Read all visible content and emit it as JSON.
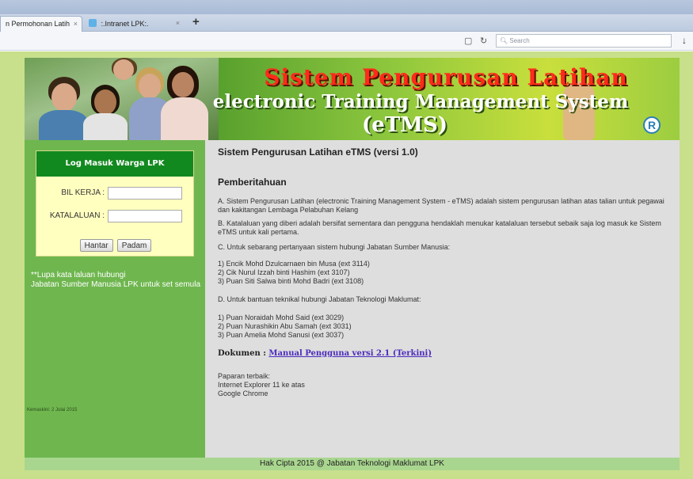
{
  "browser": {
    "window_title": "",
    "tabs": [
      {
        "label": "n Permohonan Latih",
        "active": true
      },
      {
        "label": ":.Intranet LPK:.",
        "active": false
      }
    ],
    "new_tab": "+",
    "close_glyph": "×",
    "search_placeholder": "Search",
    "nav_icons": [
      "reader-icon",
      "reload-icon",
      "search-icon",
      "download-icon"
    ]
  },
  "banner": {
    "title_line1": "Sistem Pengurusan Latihan",
    "title_line2": "electronic Training Management System",
    "title_line3": "(eTMS)",
    "logo": "R"
  },
  "login": {
    "heading": "Log Masuk Warga LPK",
    "fields": [
      {
        "label": "BIL KERJA :",
        "value": "",
        "placeholder": ""
      },
      {
        "label": "KATALALUAN :",
        "value": "",
        "placeholder": ""
      }
    ],
    "submit_label": "Hantar",
    "reset_label": "Padam"
  },
  "sidebar": {
    "forgot_line1": "**Lupa kata laluan hubungi",
    "forgot_line2": "Jabatan Sumber Manusia LPK untuk set semula",
    "updated": "Kemaskini: 2 Julai 2015"
  },
  "content": {
    "title": "Sistem Pengurusan Latihan eTMS (versi 1.0)",
    "heading": "Pemberitahuan",
    "para_a": "A. Sistem Pengurusan Latihan (electronic Training Management System - eTMS) adalah sistem pengurusan latihan atas talian untuk pegawai dan kakitangan Lembaga Pelabuhan Kelang",
    "para_b": "B. Katalaluan yang diberi adalah bersifat sementara dan pengguna hendaklah menukar katalaluan tersebut sebaik saja log masuk ke Sistem eTMS untuk kali pertama.",
    "para_c": "C. Untuk sebarang pertanyaan sistem hubungi Jabatan Sumber Manusia:",
    "hr_contacts": [
      "1) Encik Mohd Dzulcarnaen bin Musa (ext 3114)",
      "2) Cik Nurul Izzah binti Hashim (ext 3107)",
      "3) Puan Siti Salwa binti Mohd Badri (ext 3108)"
    ],
    "para_d": "D. Untuk bantuan teknikal hubungi Jabatan Teknologi Maklumat:",
    "it_contacts": [
      "1) Puan Noraidah Mohd Said (ext 3029)",
      "2) Puan Nurashikin Abu Samah (ext 3031)",
      "3) Puan Amelia Mohd Sanusi (ext 3037)"
    ],
    "doc_label": "Dokumen :",
    "doc_link": "Manual Pengguna versi 2.1 (Terkini)",
    "browsers_label": "Paparan terbaik:",
    "browsers": [
      "Internet Explorer 11 ke atas",
      "Google Chrome"
    ]
  },
  "footer": {
    "text": "Hak Cipta 2015 @ Jabatan Teknologi Maklumat LPK"
  }
}
